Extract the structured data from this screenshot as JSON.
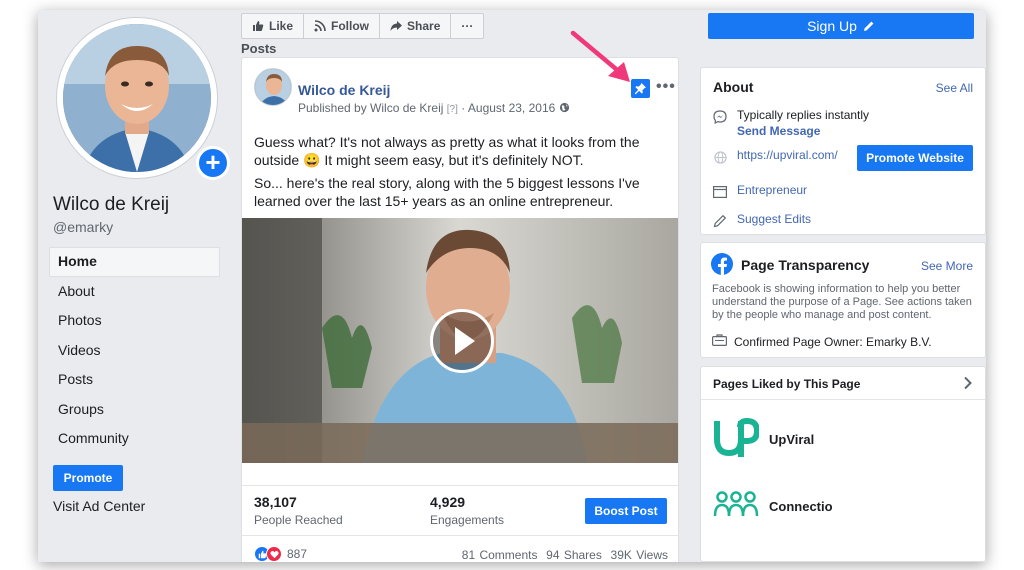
{
  "page": {
    "name": "Wilco de Kreij",
    "handle": "@emarky"
  },
  "nav": {
    "items": [
      {
        "label": "Home",
        "active": true
      },
      {
        "label": "About"
      },
      {
        "label": "Photos"
      },
      {
        "label": "Videos"
      },
      {
        "label": "Posts"
      },
      {
        "label": "Groups"
      },
      {
        "label": "Community"
      }
    ],
    "promote_label": "Promote",
    "ad_center_label": "Visit Ad Center"
  },
  "actionbar": {
    "like_label": "Like",
    "follow_label": "Follow",
    "share_label": "Share",
    "more_label": "···"
  },
  "signup_label": "Sign Up",
  "posts_heading": "Posts",
  "post": {
    "author": "Wilco de Kreij",
    "published_by": "Published by Wilco de Kreij",
    "help_marker": "[?]",
    "separator": "·",
    "date": "August 23, 2016",
    "more_label": "•••",
    "text_1": "Guess what? It's not always as pretty as what it looks from the outside 😀 It might seem easy, but it's definitely NOT.",
    "text_2": "So... here's the real story, along with the 5 biggest lessons I've learned over the last 15+ years as an online entrepreneur.",
    "people_reached": "38,107",
    "people_reached_label": "People Reached",
    "engagements": "4,929",
    "engagements_label": "Engagements",
    "boost_label": "Boost Post",
    "reactions_count": "887",
    "comments": "81 Comments",
    "shares": "94 Shares",
    "views": "39K Views"
  },
  "about": {
    "title": "About",
    "see_all": "See All",
    "replies": "Typically replies instantly",
    "send_message": "Send Message",
    "website": "https://upviral.com/",
    "promote_website": "Promote Website",
    "category": "Entrepreneur",
    "suggest_edits": "Suggest Edits"
  },
  "transparency": {
    "title": "Page Transparency",
    "see_more": "See More",
    "description": "Facebook is showing information to help you better understand the purpose of a Page. See actions taken by the people who manage and post content.",
    "owner": "Confirmed Page Owner: Emarky B.V."
  },
  "liked": {
    "title": "Pages Liked by This Page",
    "pages": [
      {
        "name": "UpViral"
      },
      {
        "name": "Connectio"
      }
    ]
  },
  "colors": {
    "brand": "#1877f2",
    "link": "#4267b2",
    "teal": "#1ab394",
    "arrow": "#f0397a"
  },
  "icons": [
    "like-icon",
    "rss-icon",
    "share-icon",
    "pencil-icon",
    "pin-icon",
    "globe-icon",
    "messenger-icon",
    "link-globe-icon",
    "category-icon",
    "pencil-edit-icon",
    "facebook-icon",
    "id-card-icon",
    "chevron-right-icon",
    "play-icon",
    "annotation-arrow"
  ]
}
